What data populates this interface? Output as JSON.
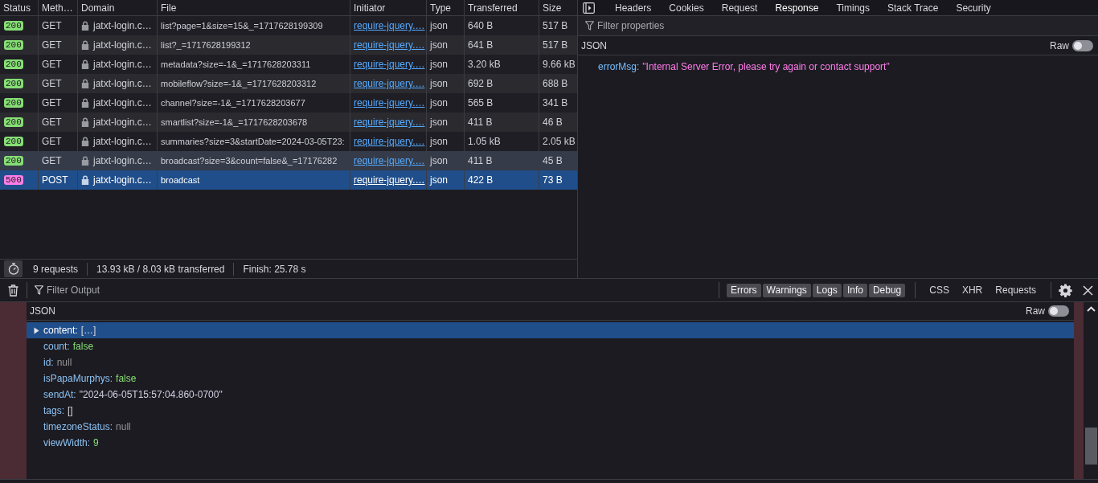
{
  "network": {
    "columns": [
      "Status",
      "Meth…",
      "Domain",
      "File",
      "Initiator",
      "Type",
      "Transferred",
      "Size"
    ],
    "rows": [
      {
        "status": "200",
        "color": "#86de74",
        "method": "GET",
        "domain": "jatxt-login.c…",
        "file": "list?page=1&size=15&_=1717628199309",
        "initiator": "require-jquery.…",
        "type": "json",
        "transferred": "640 B",
        "size": "517 B",
        "hovered": false,
        "selected": false
      },
      {
        "status": "200",
        "color": "#86de74",
        "method": "GET",
        "domain": "jatxt-login.c…",
        "file": "list?_=1717628199312",
        "initiator": "require-jquery.…",
        "type": "json",
        "transferred": "641 B",
        "size": "517 B",
        "hovered": false,
        "selected": false
      },
      {
        "status": "200",
        "color": "#86de74",
        "method": "GET",
        "domain": "jatxt-login.c…",
        "file": "metadata?size=-1&_=1717628203311",
        "initiator": "require-jquery.…",
        "type": "json",
        "transferred": "3.20 kB",
        "size": "9.66 kB",
        "hovered": false,
        "selected": false
      },
      {
        "status": "200",
        "color": "#86de74",
        "method": "GET",
        "domain": "jatxt-login.c…",
        "file": "mobileflow?size=-1&_=1717628203312",
        "initiator": "require-jquery.…",
        "type": "json",
        "transferred": "692 B",
        "size": "688 B",
        "hovered": false,
        "selected": false
      },
      {
        "status": "200",
        "color": "#86de74",
        "method": "GET",
        "domain": "jatxt-login.c…",
        "file": "channel?size=-1&_=1717628203677",
        "initiator": "require-jquery.…",
        "type": "json",
        "transferred": "565 B",
        "size": "341 B",
        "hovered": false,
        "selected": false
      },
      {
        "status": "200",
        "color": "#86de74",
        "method": "GET",
        "domain": "jatxt-login.c…",
        "file": "smartlist?size=-1&_=1717628203678",
        "initiator": "require-jquery.…",
        "type": "json",
        "transferred": "411 B",
        "size": "46 B",
        "hovered": false,
        "selected": false
      },
      {
        "status": "200",
        "color": "#86de74",
        "method": "GET",
        "domain": "jatxt-login.c…",
        "file": "summaries?size=3&startDate=2024-03-05T23:",
        "initiator": "require-jquery.…",
        "type": "json",
        "transferred": "1.05 kB",
        "size": "2.05 kB",
        "hovered": false,
        "selected": false
      },
      {
        "status": "200",
        "color": "#86de74",
        "method": "GET",
        "domain": "jatxt-login.c…",
        "file": "broadcast?size=3&count=false&_=17176282",
        "initiator": "require-jquery.…",
        "type": "json",
        "transferred": "411 B",
        "size": "45 B",
        "hovered": true,
        "selected": false
      },
      {
        "status": "500",
        "color": "#ff7de9",
        "method": "POST",
        "domain": "jatxt-login.c…",
        "file": "broadcast",
        "initiator": "require-jquery.…",
        "type": "json",
        "transferred": "422 B",
        "size": "73 B",
        "hovered": false,
        "selected": true
      }
    ],
    "summary": [
      "9 requests",
      "13.93 kB / 8.03 kB transferred",
      "Finish: 25.78 s"
    ]
  },
  "details": {
    "tabs": [
      {
        "label": "Headers",
        "selected": false
      },
      {
        "label": "Cookies",
        "selected": false
      },
      {
        "label": "Request",
        "selected": false
      },
      {
        "label": "Response",
        "selected": true
      },
      {
        "label": "Timings",
        "selected": false
      },
      {
        "label": "Stack Trace",
        "selected": false
      },
      {
        "label": "Security",
        "selected": false
      }
    ],
    "filter": {
      "placeholder": "Filter properties"
    },
    "section": {
      "title": "JSON",
      "raw_label": "Raw",
      "raw_on": false
    },
    "properties": [
      {
        "key": "errorMsg:",
        "value": "\"Internal Server Error, please try again or contact support\"",
        "kind": "string",
        "selected": false
      }
    ]
  },
  "console": {
    "filter": {
      "placeholder": "Filter Output"
    },
    "level_filters": [
      {
        "label": "Errors",
        "selected": true
      },
      {
        "label": "Warnings",
        "selected": true
      },
      {
        "label": "Logs",
        "selected": true
      },
      {
        "label": "Info",
        "selected": true
      },
      {
        "label": "Debug",
        "selected": true
      }
    ],
    "type_filters": [
      {
        "label": "CSS",
        "selected": false
      },
      {
        "label": "XHR",
        "selected": false
      },
      {
        "label": "Requests",
        "selected": false
      }
    ],
    "section": {
      "title": "JSON",
      "raw_label": "Raw",
      "raw_on": false
    },
    "properties": [
      {
        "key": "content:",
        "value": "[…]",
        "kind": "array",
        "expanded": false,
        "selected": true
      },
      {
        "key": "count:",
        "value": "false",
        "kind": "boolean",
        "selected": false
      },
      {
        "key": "id:",
        "value": "null",
        "kind": "null",
        "selected": false
      },
      {
        "key": "isPapaMurphys:",
        "value": "false",
        "kind": "boolean",
        "selected": false
      },
      {
        "key": "sendAt:",
        "value": "\"2024-06-05T15:57:04.860-0700\"",
        "kind": "string",
        "selected": false
      },
      {
        "key": "tags:",
        "value": "[]",
        "kind": "array",
        "selected": false
      },
      {
        "key": "timezoneStatus:",
        "value": "null",
        "kind": "null",
        "selected": false
      },
      {
        "key": "viewWidth:",
        "value": "9",
        "kind": "number",
        "selected": false
      }
    ]
  }
}
